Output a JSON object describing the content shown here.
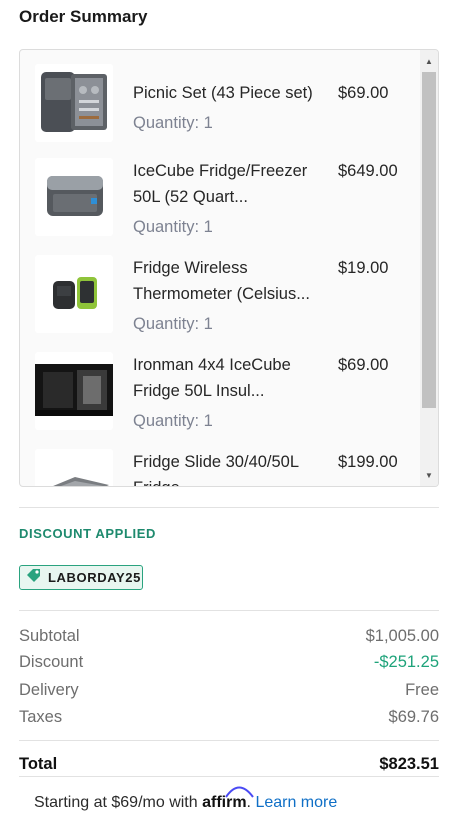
{
  "header": {
    "title": "Order Summary"
  },
  "items": [
    {
      "name_line1": "Picnic Set (43 Piece set)",
      "name_line2": "",
      "price": "$69.00",
      "quantity": "Quantity: 1"
    },
    {
      "name_line1": "IceCube Fridge/Freezer",
      "name_line2": "50L (52 Quart...",
      "price": "$649.00",
      "quantity": "Quantity: 1"
    },
    {
      "name_line1": "Fridge Wireless",
      "name_line2": "Thermometer (Celsius...",
      "price": "$19.00",
      "quantity": "Quantity: 1"
    },
    {
      "name_line1": "Ironman 4x4 IceCube",
      "name_line2": "Fridge 50L Insul...",
      "price": "$69.00",
      "quantity": "Quantity: 1"
    },
    {
      "name_line1": "Fridge Slide 30/40/50L",
      "name_line2": "Fridge...",
      "price": "$199.00",
      "quantity": ""
    }
  ],
  "discount": {
    "heading": "DISCOUNT APPLIED",
    "code": "LABORDAY25"
  },
  "summary": {
    "subtotal_label": "Subtotal",
    "subtotal_value": "$1,005.00",
    "discount_label": "Discount",
    "discount_value": "-$251.25",
    "delivery_label": "Delivery",
    "delivery_value": "Free",
    "taxes_label": "Taxes",
    "taxes_value": "$69.76",
    "total_label": "Total",
    "total_value": "$823.51"
  },
  "financing": {
    "prefix": "Starting at $69/mo with ",
    "brand": "affirm",
    "suffix": ". ",
    "link": "Learn more"
  },
  "colors": {
    "accent_green": "#1ea37a",
    "link_blue": "#0f6fc6"
  }
}
